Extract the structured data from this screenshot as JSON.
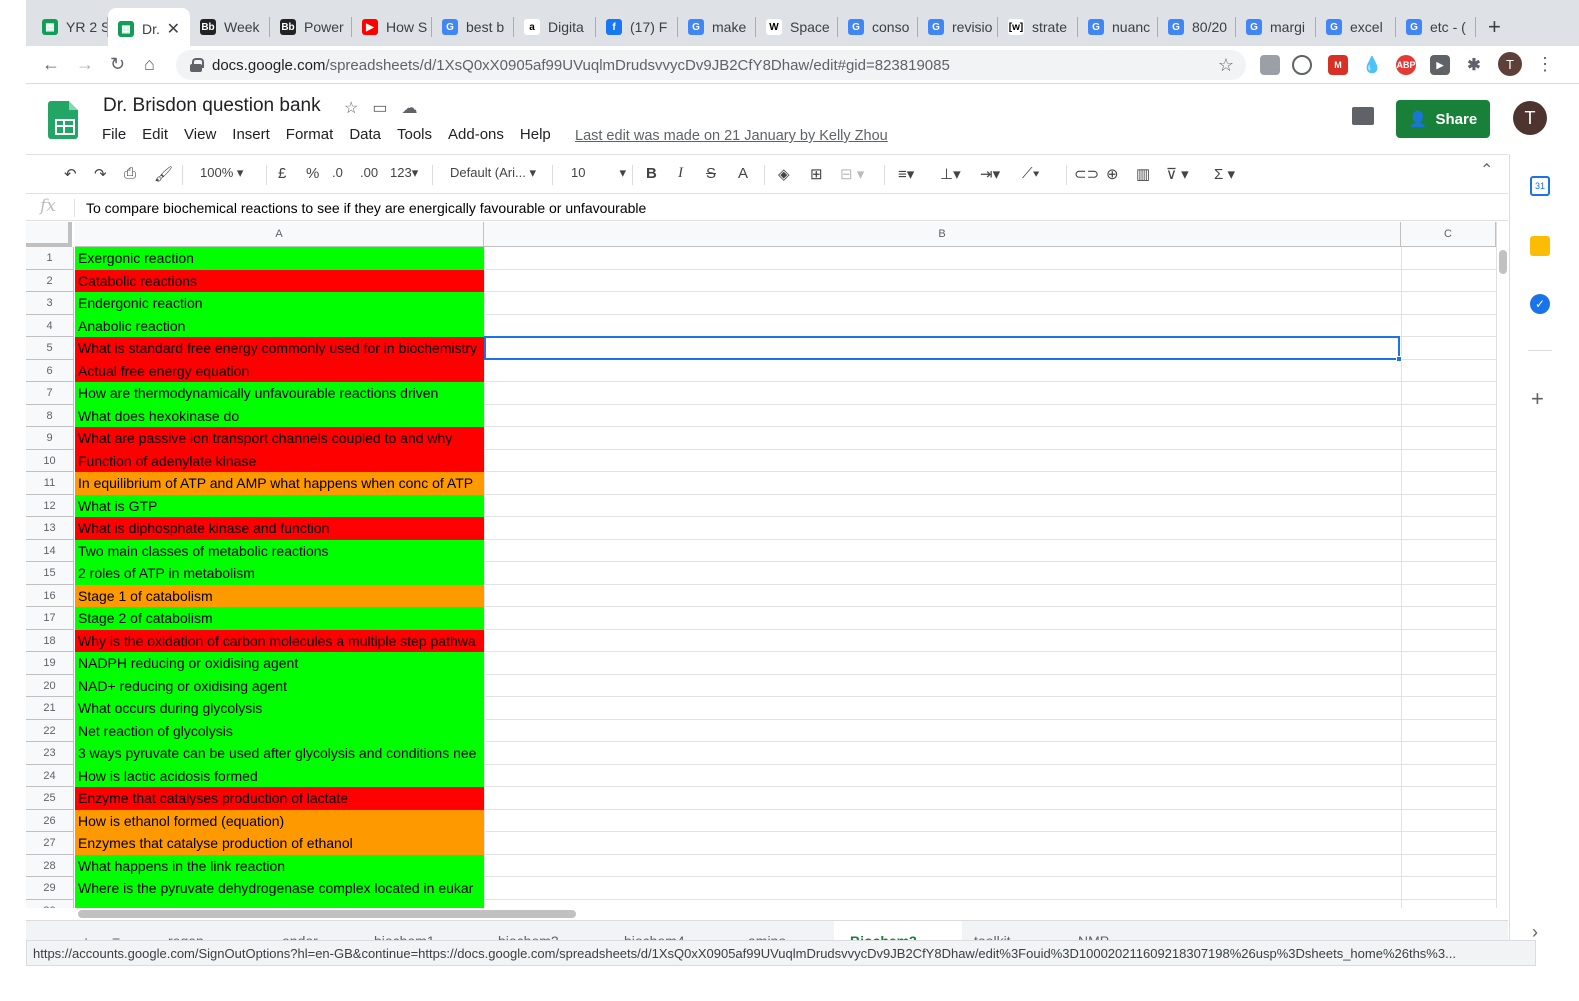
{
  "browser": {
    "tabs": [
      {
        "label": "YR 2 S",
        "color": "#0f9d58",
        "glyph": "▦"
      },
      {
        "label": "Dr.",
        "color": "#0f9d58",
        "glyph": "▦",
        "active": true
      },
      {
        "label": "Week",
        "color": "#222222",
        "glyph": "Bb"
      },
      {
        "label": "Power",
        "color": "#222222",
        "glyph": "Bb"
      },
      {
        "label": "How S",
        "color": "#ff0000",
        "glyph": "▶"
      },
      {
        "label": "best b",
        "color": "#4285f4",
        "glyph": "G"
      },
      {
        "label": "Digita",
        "color": "#ffffff",
        "glyph": "a"
      },
      {
        "label": "(17) F",
        "color": "#1877f2",
        "glyph": "f"
      },
      {
        "label": "make",
        "color": "#4285f4",
        "glyph": "G"
      },
      {
        "label": "Space",
        "color": "#ffffff",
        "glyph": "W"
      },
      {
        "label": "conso",
        "color": "#4285f4",
        "glyph": "G"
      },
      {
        "label": "revisio",
        "color": "#4285f4",
        "glyph": "G"
      },
      {
        "label": "strate",
        "color": "#ffffff",
        "glyph": "[w]"
      },
      {
        "label": "nuanc",
        "color": "#4285f4",
        "glyph": "G"
      },
      {
        "label": "80/20",
        "color": "#4285f4",
        "glyph": "G"
      },
      {
        "label": "margi",
        "color": "#4285f4",
        "glyph": "G"
      },
      {
        "label": "excel",
        "color": "#4285f4",
        "glyph": "G"
      },
      {
        "label": "etc - (",
        "color": "#4285f4",
        "glyph": "G"
      }
    ],
    "url_host": "docs.google.com",
    "url_path": "/spreadsheets/d/1XsQ0xX0905af99UVuqlmDrudsvvycDv9JB2CfY8Dhaw/edit#gid=823819085",
    "profile_initial": "T"
  },
  "doc": {
    "title": "Dr. Brisdon question bank",
    "menu": [
      "File",
      "Edit",
      "View",
      "Insert",
      "Format",
      "Data",
      "Tools",
      "Add-ons",
      "Help"
    ],
    "last_edit": "Last edit was made on 21 January by Kelly Zhou",
    "share_label": "Share",
    "avatar_initial": "T"
  },
  "toolbar": {
    "zoom": "100%",
    "currency": "£",
    "percent": "%",
    "dec_less": ".0",
    "dec_more": ".00",
    "format_more": "123",
    "font": "Default (Ari...",
    "font_size": "10",
    "bold": "B",
    "italic": "I",
    "strike": "S",
    "text_color": "A",
    "sum": "Σ"
  },
  "formula_bar": {
    "fx": "fx",
    "content": "To compare biochemical reactions to see if they are energically favourable or unfavourable"
  },
  "columns": [
    "A",
    "B",
    "C"
  ],
  "rows": [
    {
      "n": "1",
      "text": "Exergonic reaction",
      "fill": "green"
    },
    {
      "n": "2",
      "text": "Catabolic reactions",
      "fill": "red"
    },
    {
      "n": "3",
      "text": "Endergonic reaction",
      "fill": "green"
    },
    {
      "n": "4",
      "text": "Anabolic reaction",
      "fill": "green"
    },
    {
      "n": "5",
      "text": "What is standard free energy commonly used for in biochemistry",
      "fill": "red"
    },
    {
      "n": "6",
      "text": "Actual free energy equation",
      "fill": "red"
    },
    {
      "n": "7",
      "text": "How are thermodynamically unfavourable reactions driven",
      "fill": "green"
    },
    {
      "n": "8",
      "text": "What does hexokinase do",
      "fill": "green"
    },
    {
      "n": "9",
      "text": "What are passive ion transport channels coupled to and why",
      "fill": "red"
    },
    {
      "n": "10",
      "text": "Function of adenylate kinase",
      "fill": "red"
    },
    {
      "n": "11",
      "text": "In equilibrium of ATP and AMP what happens when conc of ATP",
      "fill": "orange"
    },
    {
      "n": "12",
      "text": "What is GTP",
      "fill": "green"
    },
    {
      "n": "13",
      "text": "What is diphosphate kinase and function",
      "fill": "red"
    },
    {
      "n": "14",
      "text": "Two main classes of metabolic reactions",
      "fill": "green"
    },
    {
      "n": "15",
      "text": "2 roles of ATP in metabolism",
      "fill": "green"
    },
    {
      "n": "16",
      "text": "Stage 1 of catabolism",
      "fill": "orange"
    },
    {
      "n": "17",
      "text": "Stage 2 of catabolism",
      "fill": "green"
    },
    {
      "n": "18",
      "text": "Why is the oxidation of carbon molecules a multiple step pathwa",
      "fill": "red"
    },
    {
      "n": "19",
      "text": "NADPH reducing or oxidising agent",
      "fill": "green"
    },
    {
      "n": "20",
      "text": "NAD+ reducing or oxidising agent",
      "fill": "green"
    },
    {
      "n": "21",
      "text": "What occurs during glycolysis",
      "fill": "green"
    },
    {
      "n": "22",
      "text": "Net reaction of glycolysis",
      "fill": "green"
    },
    {
      "n": "23",
      "text": "3 ways pyruvate can be used after glycolysis and conditions nee",
      "fill": "green"
    },
    {
      "n": "24",
      "text": "How is lactic acidosis formed",
      "fill": "green"
    },
    {
      "n": "25",
      "text": "Enzyme that catalyses production of lactate",
      "fill": "red"
    },
    {
      "n": "26",
      "text": "How is ethanol formed (equation)",
      "fill": "orange"
    },
    {
      "n": "27",
      "text": "Enzymes that catalyse production of ethanol",
      "fill": "orange"
    },
    {
      "n": "28",
      "text": "What happens in the link reaction",
      "fill": "green"
    },
    {
      "n": "29",
      "text": "Where is the pyruvate dehydrogenase complex located in eukar",
      "fill": "green"
    },
    {
      "n": "30",
      "text": "",
      "fill": "green"
    }
  ],
  "sheet_tabs": [
    "+",
    "≡",
    "regen",
    "endor",
    "biochem1",
    "biochem2",
    "biochem4",
    "amino",
    "Biochem3",
    "toolkit",
    "NMP"
  ],
  "active_sheet": "Biochem3",
  "status_url": "https://accounts.google.com/SignOutOptions?hl=en-GB&continue=https://docs.google.com/spreadsheets/d/1XsQ0xX0905af99UVuqlmDrudsvvycDv9JB2CfY8Dhaw/edit%3Fouid%3D100020211609218307198%26usp%3Dsheets_home%26ths%3..."
}
